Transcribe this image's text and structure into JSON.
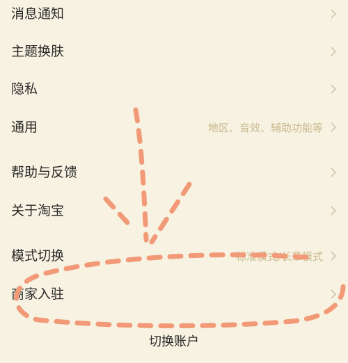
{
  "menu": {
    "items": [
      {
        "label": "消息通知",
        "detail": ""
      },
      {
        "label": "主题换肤",
        "detail": ""
      },
      {
        "label": "隐私",
        "detail": ""
      },
      {
        "label": "通用",
        "detail": "地区、音效、辅助功能等"
      },
      {
        "label": "帮助与反馈",
        "detail": ""
      },
      {
        "label": "关于淘宝",
        "detail": ""
      },
      {
        "label": "模式切换",
        "detail": "标准模式/长辈模式"
      },
      {
        "label": "商家入驻",
        "detail": ""
      }
    ]
  },
  "footer": {
    "switch_account_label": "切换账户"
  },
  "icons": {
    "chevron": "chevron-right-icon"
  },
  "colors": {
    "background": "#f7f2e1",
    "annotation": "#f29a78",
    "detail_text": "#c9b98f",
    "chevron": "#cfc6b0"
  }
}
